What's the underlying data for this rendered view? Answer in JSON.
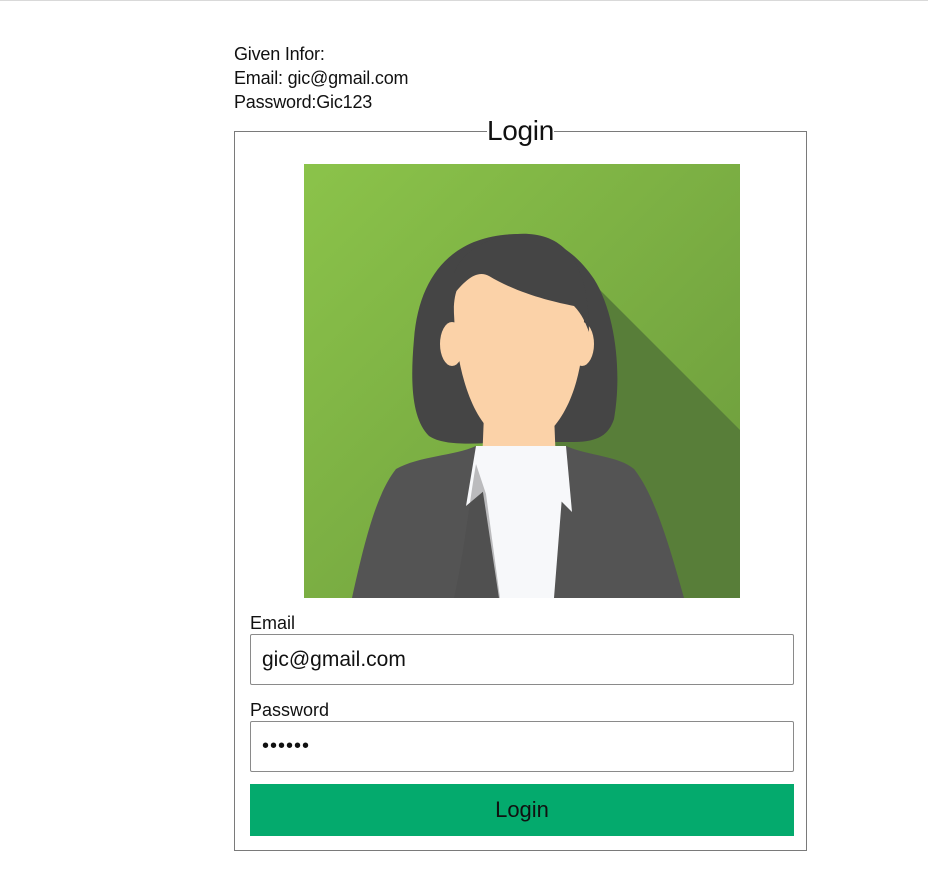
{
  "given_info": {
    "heading": "Given Infor:",
    "email_line": "Email: gic@gmail.com",
    "password_line": "Password:Gic123"
  },
  "login_form": {
    "legend": "Login",
    "email": {
      "label": "Email",
      "value": "gic@gmail.com"
    },
    "password": {
      "label": "Password",
      "value": "Gic123"
    },
    "submit_label": "Login"
  },
  "avatar": {
    "icon": "businesswoman-avatar-icon",
    "background_color": "#8bc34a"
  },
  "colors": {
    "button": "#04aa6d",
    "fieldset_border": "#7a7a7a"
  }
}
